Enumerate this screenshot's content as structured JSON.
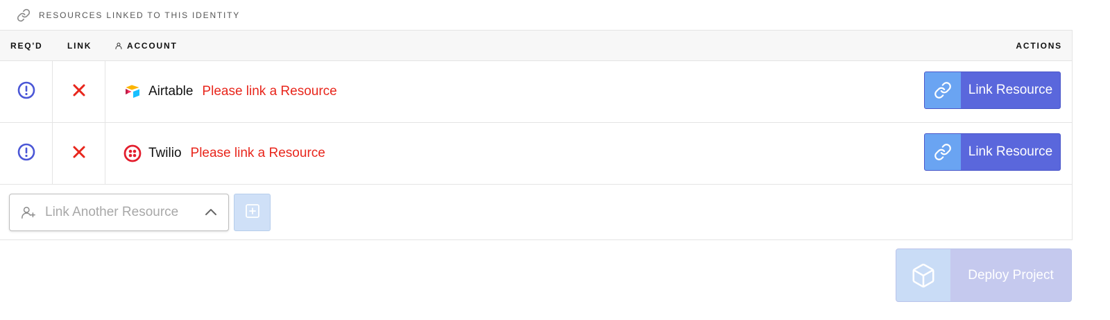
{
  "section": {
    "title": "RESOURCES LINKED TO THIS IDENTITY",
    "icon": "link-icon"
  },
  "table": {
    "headers": {
      "reqd": "REQ'D",
      "link": "LINK",
      "account": "ACCOUNT",
      "actions": "ACTIONS"
    },
    "rows": [
      {
        "required_icon": "alert-circle-icon",
        "link_status_icon": "x-icon",
        "account_logo": "airtable-logo",
        "account_name": "Airtable",
        "warning": "Please link a Resource",
        "action_label": "Link Resource"
      },
      {
        "required_icon": "alert-circle-icon",
        "link_status_icon": "x-icon",
        "account_logo": "twilio-logo",
        "account_name": "Twilio",
        "warning": "Please link a Resource",
        "action_label": "Link Resource"
      }
    ]
  },
  "link_another": {
    "placeholder": "Link Another Resource",
    "icon": "user-plus-icon",
    "chevron": "chevron-up-icon",
    "add_button_icon": "plus-square-icon"
  },
  "deploy": {
    "label": "Deploy Project",
    "icon": "box-icon"
  },
  "colors": {
    "primary": "#5a67dc",
    "primary_light": "#6aa4f2",
    "error": "#e8261c",
    "disabled": "#c5c9ee"
  }
}
